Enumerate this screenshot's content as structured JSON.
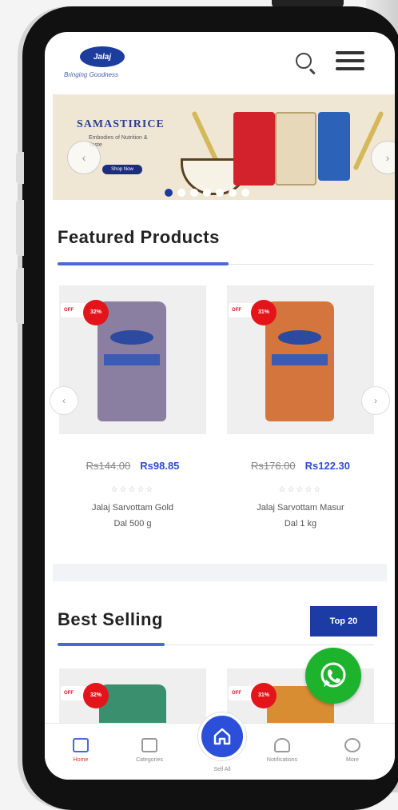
{
  "header": {
    "logo_text": "Jalaj",
    "tagline": "Bringing Goodness"
  },
  "banner": {
    "title": "SAMASTIRICE",
    "subtitle": "Embodies of Nutrition & Taste",
    "cta_label": "Shop Now"
  },
  "featured": {
    "title": "Featured Products",
    "products": [
      {
        "old_price": "Rs144.00",
        "new_price": "Rs98.85",
        "tag": "OFF",
        "discount": "32%",
        "name_line1": "Jalaj Sarvottam Gold",
        "name_line2": "Dal 500 g",
        "rating_stars": "☆☆☆☆☆"
      },
      {
        "old_price": "Rs176.00",
        "new_price": "Rs122.30",
        "tag": "OFF",
        "discount": "31%",
        "name_line1": "Jalaj Sarvottam Masur",
        "name_line2": "Dal 1 kg",
        "rating_stars": "☆☆☆☆☆"
      }
    ]
  },
  "best_selling": {
    "title": "Best Selling",
    "top_label": "Top 20",
    "products": [
      {
        "tag": "OFF",
        "discount": "32%"
      },
      {
        "tag": "OFF",
        "discount": "31%"
      }
    ]
  },
  "nav": {
    "items": [
      {
        "label": "Home",
        "icon": "home-outline-icon"
      },
      {
        "label": "Categories",
        "icon": "category-icon"
      },
      {
        "label": "Sell All",
        "icon": "home-icon"
      },
      {
        "label": "Notifications",
        "icon": "bell-icon"
      },
      {
        "label": "More",
        "icon": "more-icon"
      }
    ]
  },
  "colors": {
    "brand": "#1c3ba5",
    "accent_blue": "#2f4cd6",
    "badge_red": "#e3151b",
    "whatsapp_green": "#1db32d"
  }
}
